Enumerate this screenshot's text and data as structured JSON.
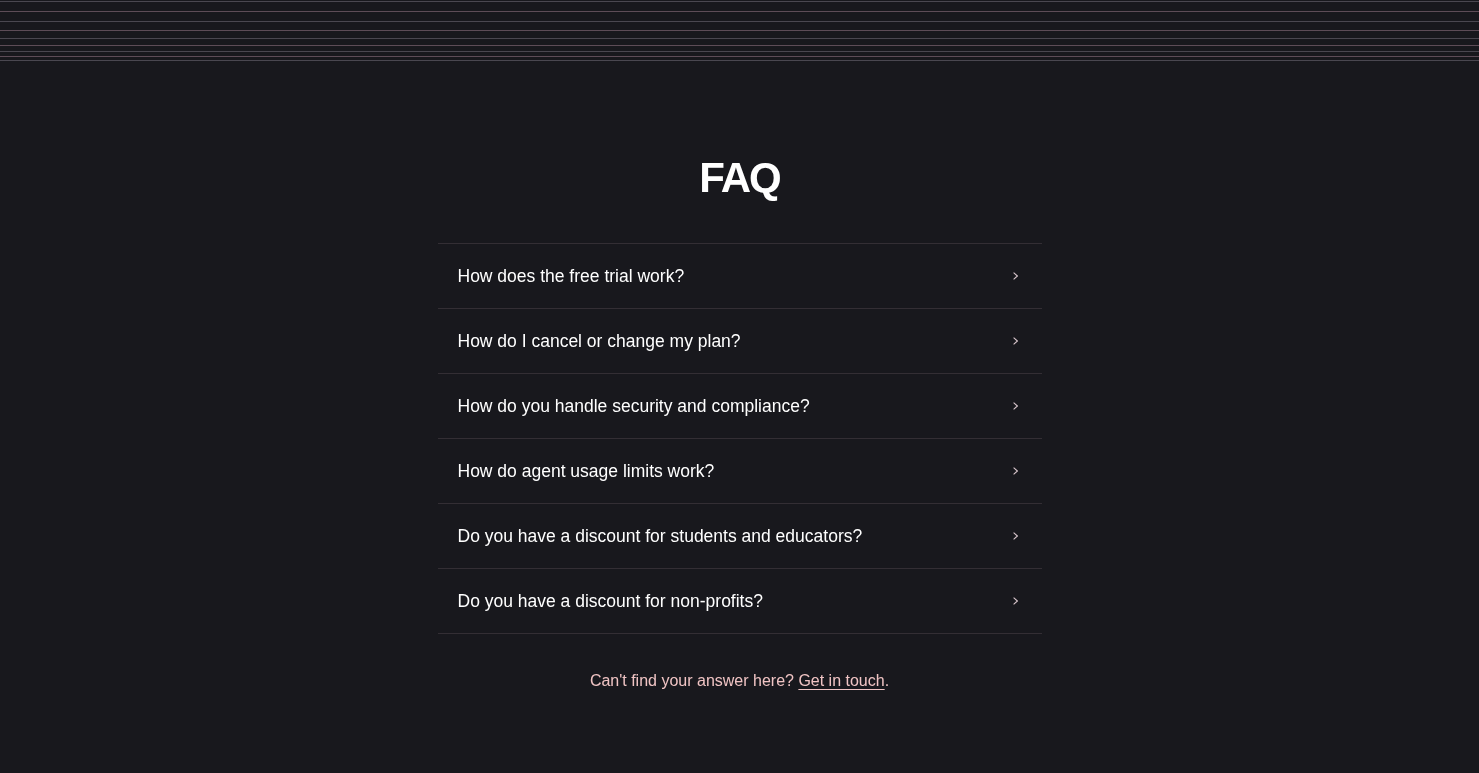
{
  "title": "FAQ",
  "questions": [
    {
      "question": "How does the free trial work?",
      "expanded": false
    },
    {
      "question": "How do I cancel or change my plan?",
      "expanded": false
    },
    {
      "question": "How do you handle security and compliance?",
      "expanded": false
    },
    {
      "question": "How do agent usage limits work?",
      "expanded": false
    },
    {
      "question": "Do you have a discount for students and educators?",
      "expanded": false
    },
    {
      "question": "Do you have a discount for non-profits?",
      "expanded": false
    }
  ],
  "footer": {
    "prefix": "Can't find your answer here?",
    "link": "Get in touch",
    "suffix": "."
  }
}
